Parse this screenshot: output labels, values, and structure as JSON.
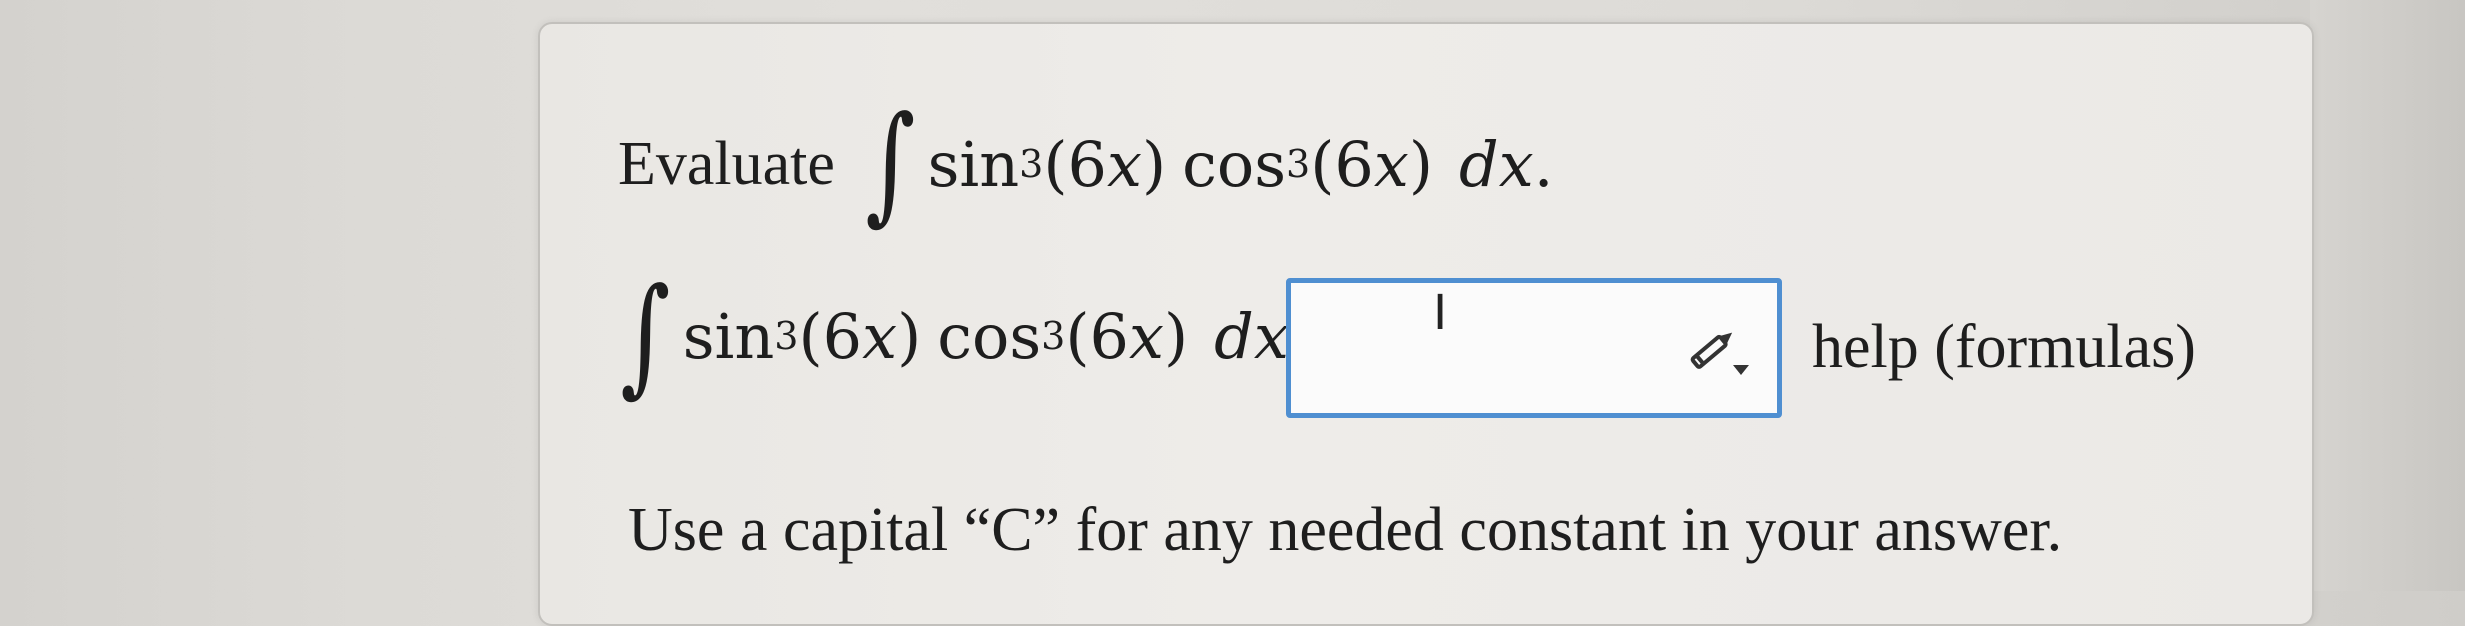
{
  "question": {
    "evaluate_label": "Evaluate",
    "integral_symbol": "∫",
    "sin": "sin",
    "cos": "cos",
    "exponent": "3",
    "argument": "(6x)",
    "arg_open": "(6",
    "arg_var": "x",
    "arg_close": ")",
    "dx_d": "d",
    "dx_x": "x",
    "period": ".",
    "equals": "="
  },
  "answer": {
    "value": "",
    "cursor_glyph": "I"
  },
  "help_link": "help (formulas)",
  "note": "Use a capital “C” for any needed constant in your answer.",
  "colors": {
    "box_border": "#4f8fd1",
    "card_bg": "#eeece9"
  }
}
